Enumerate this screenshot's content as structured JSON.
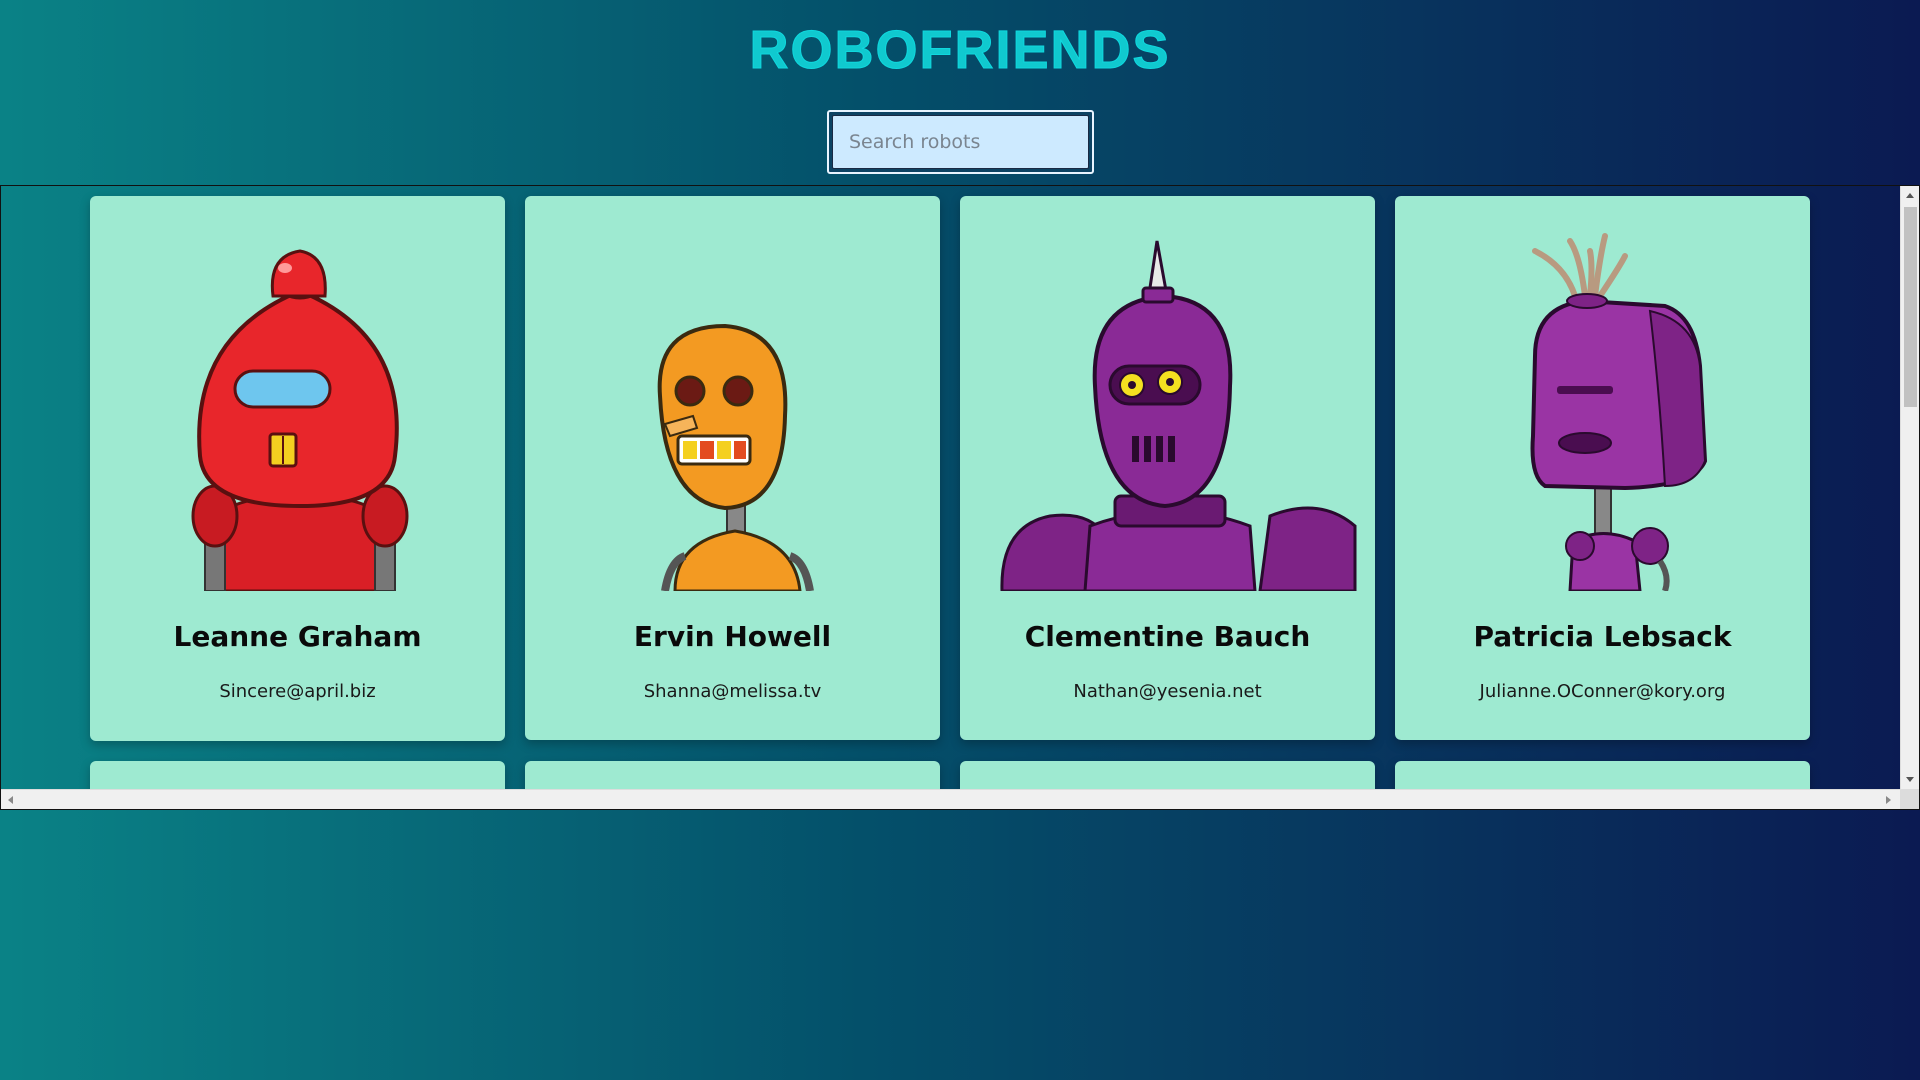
{
  "header": {
    "title": "ROBOFRIENDS"
  },
  "search": {
    "placeholder": "Search robots",
    "value": ""
  },
  "robots": [
    {
      "name": "Leanne Graham",
      "email": "Sincere@april.biz",
      "color": "#e8262b",
      "avatar": "red-robot-avatar"
    },
    {
      "name": "Ervin Howell",
      "email": "Shanna@melissa.tv",
      "color": "#f39a22",
      "avatar": "orange-robot-avatar"
    },
    {
      "name": "Clementine Bauch",
      "email": "Nathan@yesenia.net",
      "color": "#8a2a96",
      "avatar": "purple-robot-avatar"
    },
    {
      "name": "Patricia Lebsack",
      "email": "Julianne.OConner@kory.org",
      "color": "#9a34a4",
      "avatar": "purple-robot-avatar"
    }
  ],
  "colors": {
    "card_background": "#9eead1",
    "title": "#10c9cf"
  }
}
